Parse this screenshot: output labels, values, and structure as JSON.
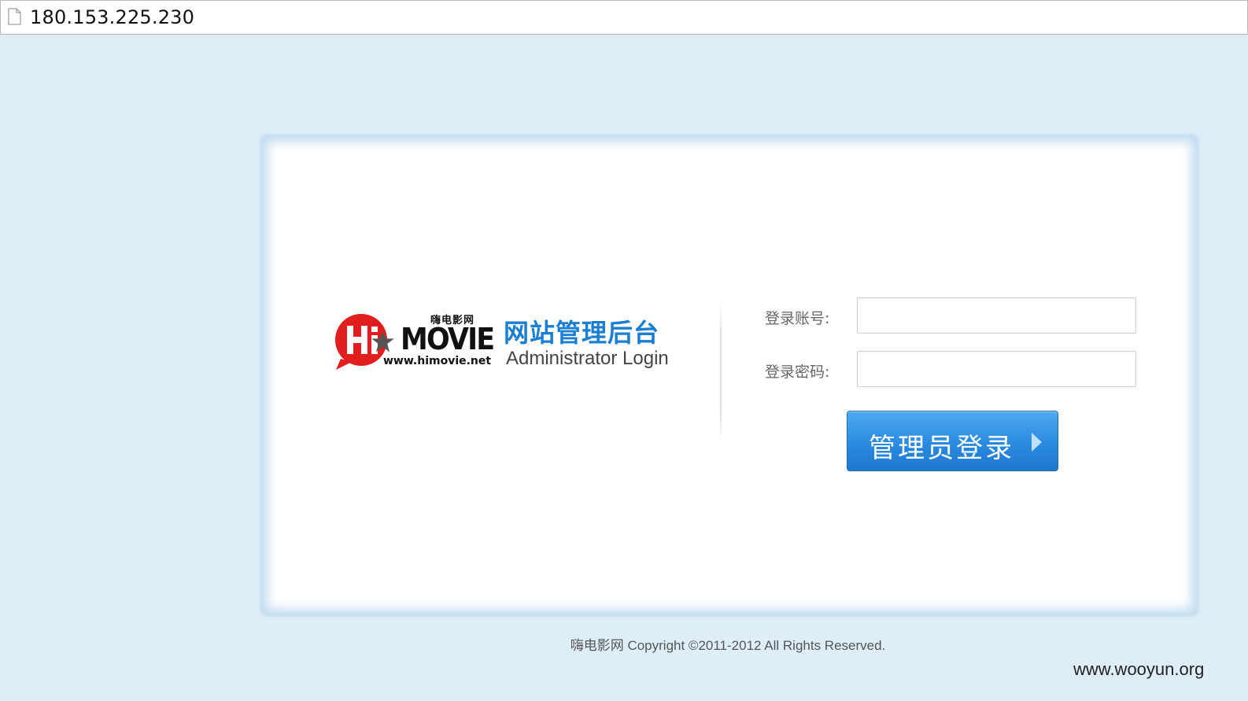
{
  "browser": {
    "url": "180.153.225.230"
  },
  "logo": {
    "cn_name": "嗨电影网",
    "brand_hi": "Hi",
    "brand_movie": "MOVIE",
    "site_url": "www.himovie.net"
  },
  "header": {
    "title_cn": "网站管理后台",
    "title_en": "Administrator Login"
  },
  "form": {
    "username_label": "登录账号:",
    "username_value": "",
    "password_label": "登录密码:",
    "password_value": "",
    "submit_label": "管理员登录"
  },
  "footer": {
    "copyright": "嗨电影网 Copyright ©2011-2012 All Rights Reserved."
  },
  "watermark": "www.wooyun.org",
  "colors": {
    "page_bg": "#deeef9",
    "accent_blue": "#1a7fd0",
    "button_blue": "#2a8ae0",
    "logo_red": "#e21d1d"
  }
}
